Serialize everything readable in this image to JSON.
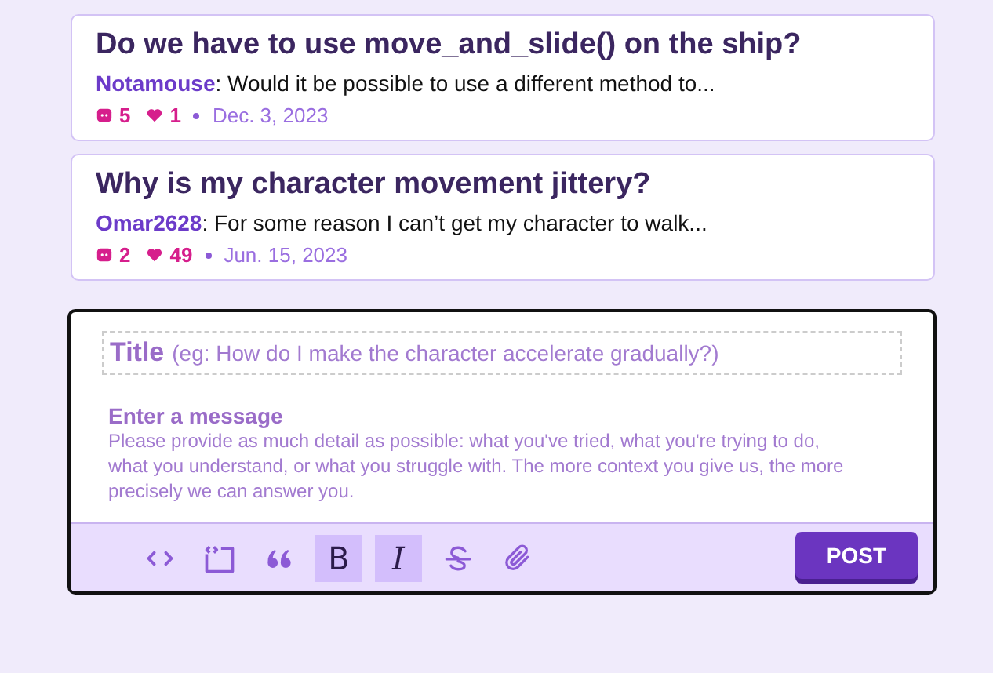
{
  "threads": [
    {
      "title": "Do we have to use move_and_slide() on the ship?",
      "author": "Notamouse",
      "excerpt": ": Would it be possible to use a different method to...",
      "replies": "5",
      "likes": "1",
      "date": "Dec. 3, 2023"
    },
    {
      "title": "Why is my character movement jittery?",
      "author": "Omar2628",
      "excerpt": ": For some reason I can’t get my character to walk...",
      "replies": "2",
      "likes": "49",
      "date": "Jun. 15, 2023"
    }
  ],
  "composer": {
    "title_field": {
      "label": "Title",
      "placeholder": "(eg: How do I make the character accelerate gradually?)"
    },
    "message_field": {
      "label": "Enter a message",
      "placeholder": "Please provide as much detail as possible: what you've tried, what you're trying to do, what you understand, or what you struggle with. The more context you give us, the more precisely we can answer you."
    },
    "tools": [
      {
        "kind": "code",
        "selected": false
      },
      {
        "kind": "snippet",
        "selected": false
      },
      {
        "kind": "quote",
        "selected": false
      },
      {
        "kind": "bold",
        "label": "B",
        "selected": true
      },
      {
        "kind": "italic",
        "label": "I",
        "selected": true
      },
      {
        "kind": "strike",
        "selected": false
      },
      {
        "kind": "attach",
        "selected": false
      }
    ],
    "submit": "POST"
  }
}
